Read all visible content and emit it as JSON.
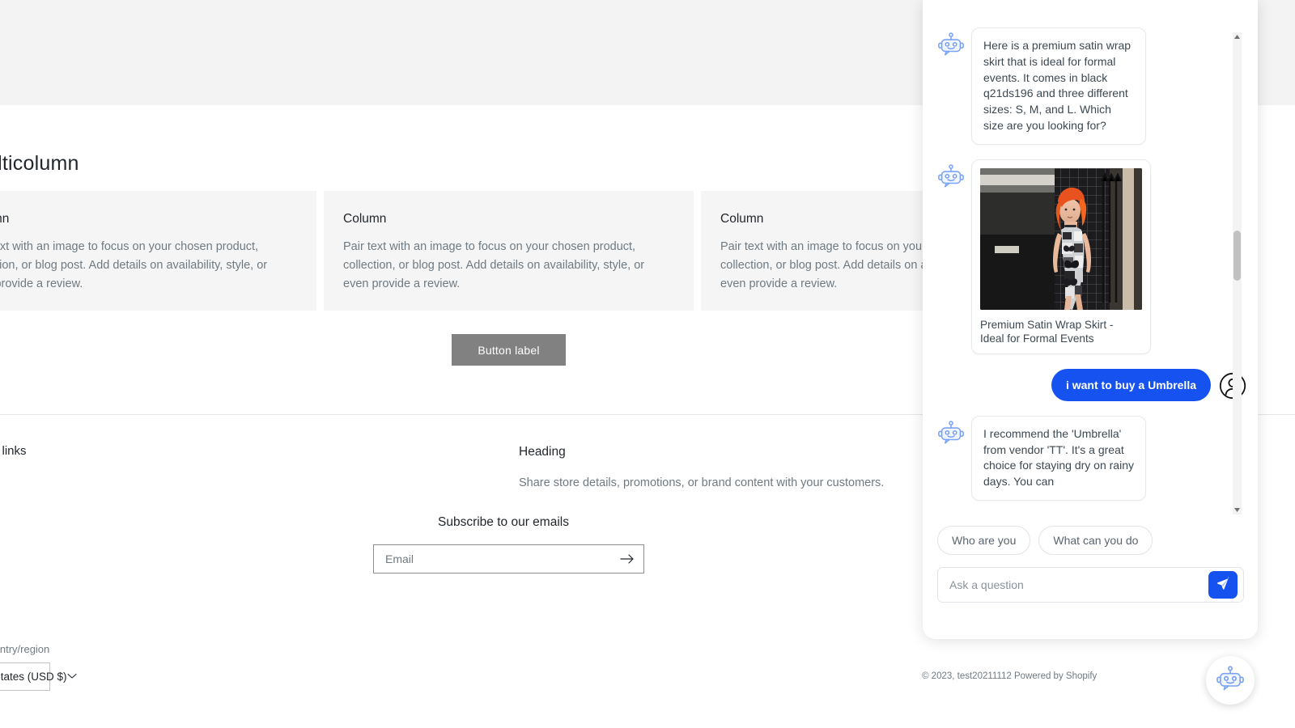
{
  "store": {
    "multicolumn_title": "Multicolumn",
    "columns": [
      {
        "title": "Column",
        "body": "Pair text with an image to focus on your chosen product, collection, or blog post. Add details on availability, style, or even provide a review."
      },
      {
        "title": "Column",
        "body": "Pair text with an image to focus on your chosen product, collection, or blog post. Add details on availability, style, or even provide a review."
      },
      {
        "title": "Column",
        "body": "Pair text with an image to focus on your chosen product, collection, or blog post. Add details on availability, style, or even provide a review."
      }
    ],
    "button_label": "Button label",
    "footer": {
      "quick_links": "Quick links",
      "heading": "Heading",
      "subtext": "Share store details, promotions, or brand content with your customers.",
      "subscribe_title": "Subscribe to our emails",
      "email_placeholder": "Email",
      "email_value": "",
      "email_submit_icon": "arrow-right-icon",
      "region_label": "Country/region",
      "region_value": "United States (USD $)",
      "copyright": "© 2023, test20211112 Powered by Shopify"
    }
  },
  "chat": {
    "bot_avatar_icon": "robot-icon",
    "user_avatar_icon": "user-avatar-icon",
    "messages": [
      {
        "role": "bot",
        "type": "text",
        "text": "Here is a premium satin wrap skirt that is ideal for formal events. It comes in black q21ds196 and three different sizes: S, M, and L. Which size are you looking for?"
      },
      {
        "role": "bot",
        "type": "product-card",
        "product_title": "Premium Satin Wrap Skirt - Ideal for Formal Events",
        "product_image_alt": "Model wearing patterned dress in front of metal grid fence"
      },
      {
        "role": "user",
        "type": "text",
        "text": "i want to buy a Umbrella"
      },
      {
        "role": "bot",
        "type": "text",
        "text": "I recommend the 'Umbrella' from vendor 'TT'. It's a great choice for staying dry on rainy days. You can"
      }
    ],
    "quick_replies": [
      "Who are you",
      "What can you do"
    ],
    "composer": {
      "placeholder": "Ask a question",
      "value": "",
      "send_icon": "send-paper-plane-icon"
    },
    "scrollbar": {
      "up_icon": "chevron-up-icon",
      "down_icon": "chevron-down-icon"
    },
    "fab_icon": "robot-icon"
  },
  "colors": {
    "accent": "#1552f0",
    "bot_icon": "#7ba3f5",
    "button_gray": "#818181",
    "text_muted": "#6f7a82"
  }
}
